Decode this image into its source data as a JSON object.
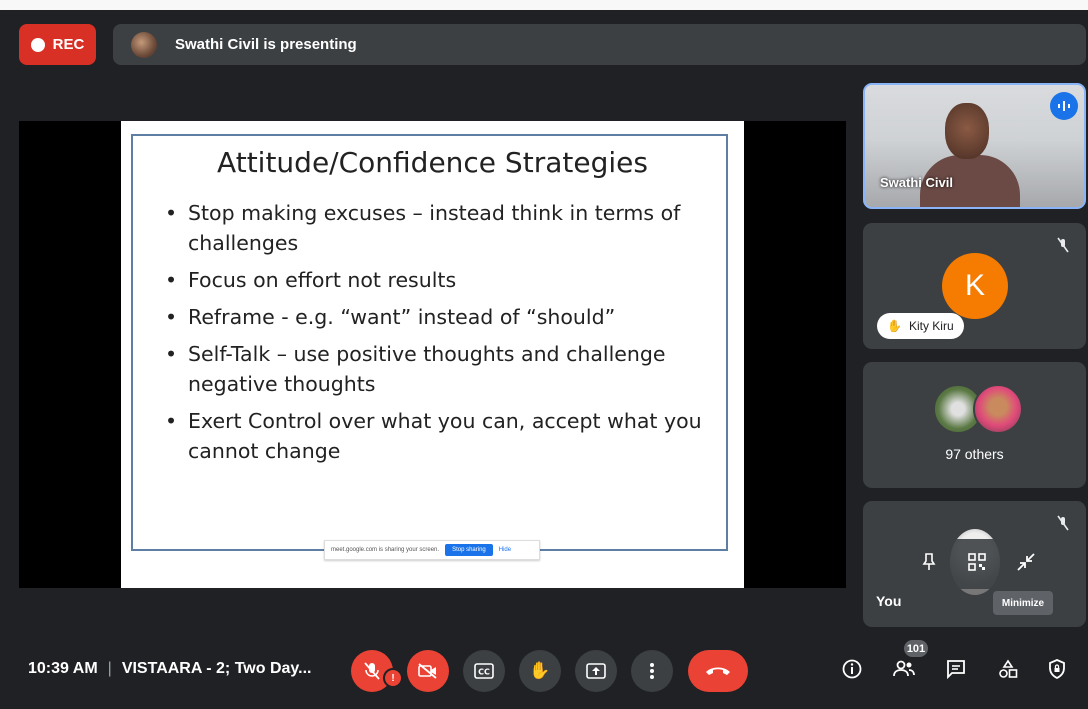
{
  "recording": {
    "label": "REC"
  },
  "presenting": {
    "text": "Swathi Civil is presenting"
  },
  "slide": {
    "title": "Attitude/Confidence Strategies",
    "bullets": [
      "Stop making excuses – instead think in terms of challenges",
      "Focus on effort not results",
      "Reframe  - e.g. “want” instead of “should”",
      "Self-Talk – use positive thoughts and challenge negative thoughts",
      "Exert Control over what you can, accept what you cannot change"
    ],
    "share_banner": {
      "text": "meet.google.com is sharing your screen.",
      "stop_label": "Stop sharing",
      "hide_label": "Hide"
    }
  },
  "participants": {
    "presenter_name": "Swathi Civil",
    "kity": {
      "initial": "K",
      "name": "Kity Kiru"
    },
    "others_label": "97 others",
    "you_label": "You",
    "tooltip": "Minimize"
  },
  "bottom": {
    "time": "10:39 AM",
    "separator": "|",
    "meeting_title": "VISTAARA - 2; Two Day...",
    "people_count": "101",
    "mic_warning": "!"
  },
  "colors": {
    "accent_red": "#ea4335",
    "rec_red": "#d93025",
    "avatar_orange": "#f57c00",
    "speaking_blue": "#1a73e8"
  }
}
